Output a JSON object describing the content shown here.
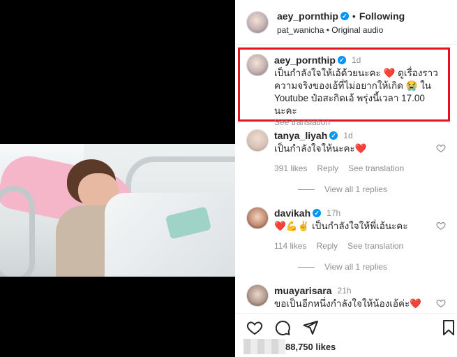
{
  "header": {
    "username": "aey_pornthip",
    "follow_status": "Following",
    "audio_line": "pat_wanicha • Original audio"
  },
  "caption": {
    "username": "aey_pornthip",
    "time": "1d",
    "text": "เป็นกำลังใจให้เอ้ด้วยนะคะ ❤️ ดูเรื่องราวความจริงของเอ้ที่ไม่อยากให้เกิด 😭 ใน Youtube ป๋อสะกิดเอ้ พรุ่งนี้เวลา 17.00 นะคะ",
    "see_translation": "See translation"
  },
  "comments": [
    {
      "username": "tanya_liyah",
      "time": "1d",
      "text": "เป็นกำลังใจให้นะคะ❤️",
      "likes": "391 likes",
      "reply": "Reply",
      "see_translation": "See translation",
      "view_replies": "View all 1 replies"
    },
    {
      "username": "davikah",
      "time": "17h",
      "text": "❤️💪✌️ เป็นกำลังใจให้พี่เอ้นะคะ",
      "likes": "114 likes",
      "reply": "Reply",
      "see_translation": "See translation",
      "view_replies": "View all 1 replies"
    },
    {
      "username": "muayarisara",
      "time": "21h",
      "text": "ขอเป็นอีกหนึ่งกำลังใจให้น้องเอ้ค่ะ❤️"
    }
  ],
  "footer": {
    "likes": "88,750 likes"
  },
  "icons": {
    "verified": "verified-badge-icon",
    "like": "heart-icon",
    "comment": "comment-icon",
    "share": "send-icon",
    "save": "bookmark-icon"
  },
  "colors": {
    "verified": "#0095f6",
    "highlight_border": "#e2141f",
    "muted_text": "#8e8e8e"
  }
}
